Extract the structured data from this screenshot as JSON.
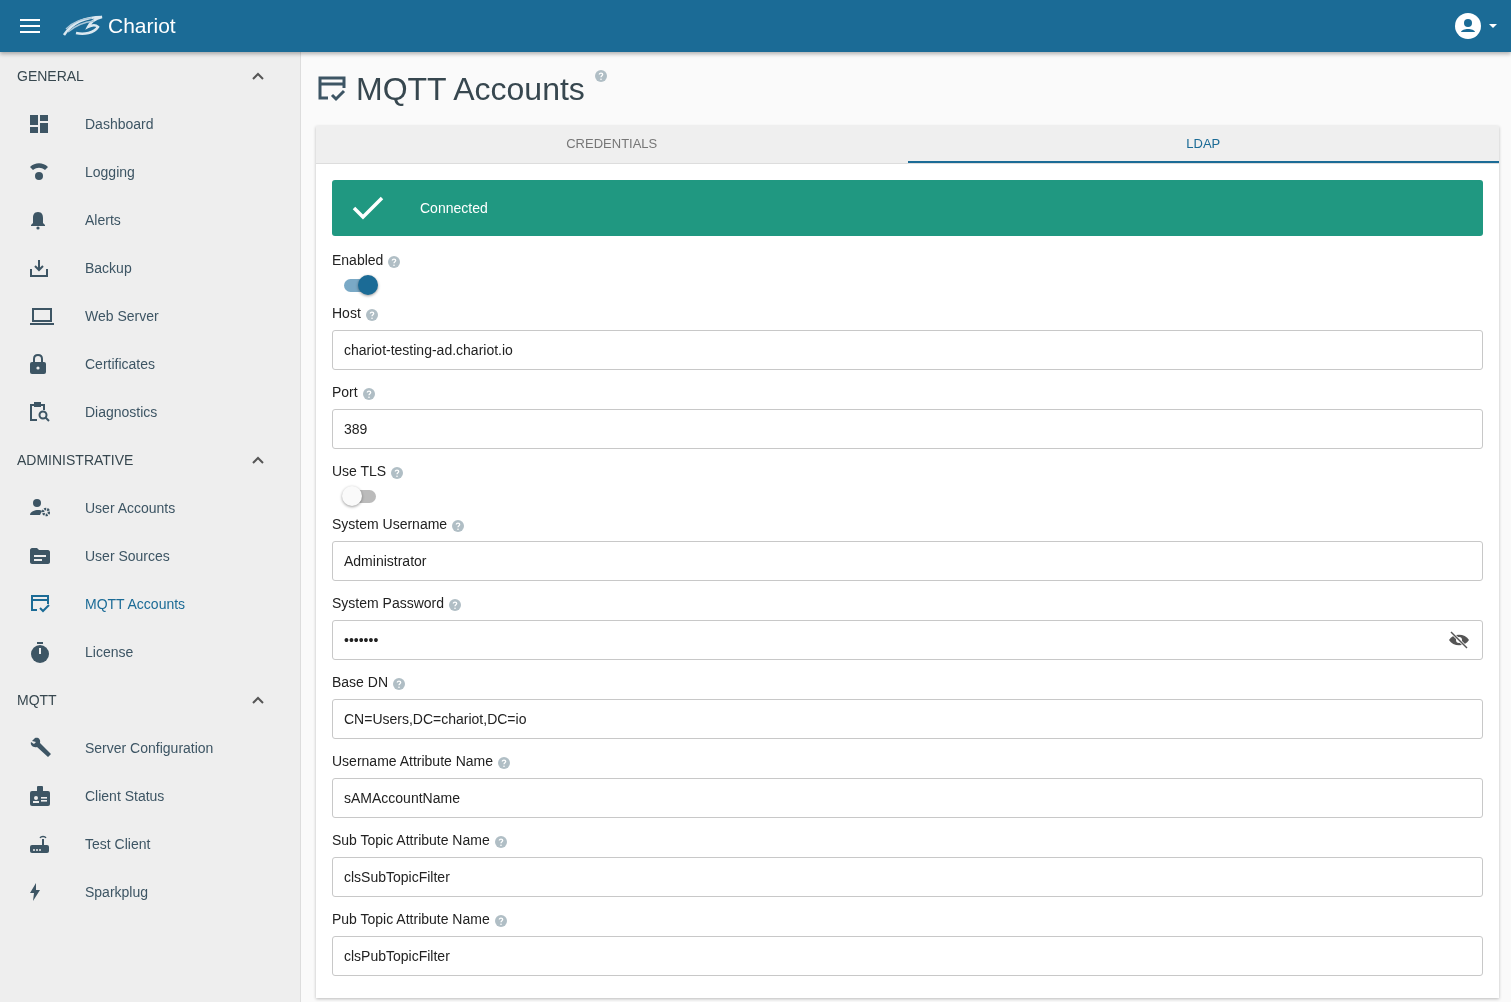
{
  "app_bar": {
    "title": "Chariot"
  },
  "sidebar": {
    "sections": [
      {
        "title": "GENERAL",
        "expanded": true,
        "items": [
          {
            "label": "Dashboard",
            "selected": false
          },
          {
            "label": "Logging",
            "selected": false
          },
          {
            "label": "Alerts",
            "selected": false
          },
          {
            "label": "Backup",
            "selected": false
          },
          {
            "label": "Web Server",
            "selected": false
          },
          {
            "label": "Certificates",
            "selected": false
          },
          {
            "label": "Diagnostics",
            "selected": false
          }
        ]
      },
      {
        "title": "ADMINISTRATIVE",
        "expanded": true,
        "items": [
          {
            "label": "User Accounts",
            "selected": false
          },
          {
            "label": "User Sources",
            "selected": false
          },
          {
            "label": "MQTT Accounts",
            "selected": true
          },
          {
            "label": "License",
            "selected": false
          }
        ]
      },
      {
        "title": "MQTT",
        "expanded": true,
        "items": [
          {
            "label": "Server Configuration",
            "selected": false
          },
          {
            "label": "Client Status",
            "selected": false
          },
          {
            "label": "Test Client",
            "selected": false
          },
          {
            "label": "Sparkplug",
            "selected": false
          }
        ]
      }
    ]
  },
  "page": {
    "title": "MQTT Accounts"
  },
  "tabs": [
    {
      "label": "CREDENTIALS",
      "selected": false
    },
    {
      "label": "LDAP",
      "selected": true
    }
  ],
  "status_banner": {
    "text": "Connected"
  },
  "fields": [
    {
      "kind": "toggle",
      "label": "Enabled",
      "on": true
    },
    {
      "kind": "text",
      "label": "Host",
      "value": "chariot-testing-ad.chariot.io"
    },
    {
      "kind": "text",
      "label": "Port",
      "value": "389"
    },
    {
      "kind": "toggle",
      "label": "Use TLS",
      "on": false
    },
    {
      "kind": "text",
      "label": "System Username",
      "value": "Administrator"
    },
    {
      "kind": "password",
      "label": "System Password",
      "value": "•••••••"
    },
    {
      "kind": "text",
      "label": "Base DN",
      "value": "CN=Users,DC=chariot,DC=io"
    },
    {
      "kind": "text",
      "label": "Username Attribute Name",
      "value": "sAMAccountName"
    },
    {
      "kind": "text",
      "label": "Sub Topic Attribute Name",
      "value": "clsSubTopicFilter"
    },
    {
      "kind": "text",
      "label": "Pub Topic Attribute Name",
      "value": "clsPubTopicFilter"
    }
  ]
}
